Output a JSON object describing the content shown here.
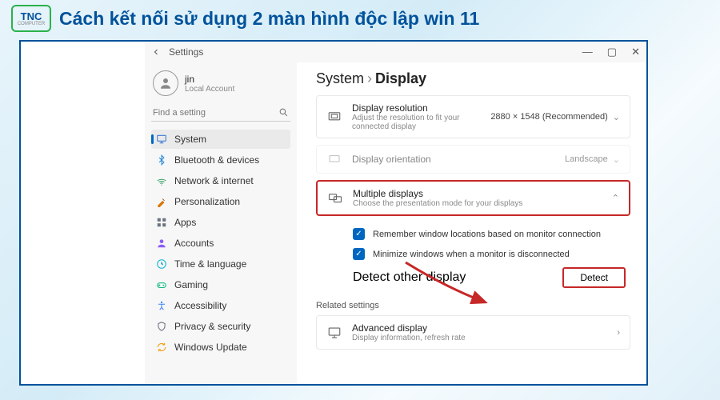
{
  "article": {
    "title": "Cách kết nối sử dụng 2 màn hình độc lập win 11",
    "logo_top": "TNC",
    "logo_bottom": "COMPUTER"
  },
  "window": {
    "title": "Settings",
    "controls": {
      "min": "—",
      "max": "▢",
      "close": "✕"
    },
    "user": {
      "name": "jin",
      "type": "Local Account"
    },
    "search_placeholder": "Find a setting",
    "nav": [
      {
        "label": "System",
        "icon": "system",
        "active": true
      },
      {
        "label": "Bluetooth & devices",
        "icon": "bt"
      },
      {
        "label": "Network & internet",
        "icon": "net"
      },
      {
        "label": "Personalization",
        "icon": "pers"
      },
      {
        "label": "Apps",
        "icon": "apps"
      },
      {
        "label": "Accounts",
        "icon": "acct"
      },
      {
        "label": "Time & language",
        "icon": "time"
      },
      {
        "label": "Gaming",
        "icon": "game"
      },
      {
        "label": "Accessibility",
        "icon": "access"
      },
      {
        "label": "Privacy & security",
        "icon": "priv"
      },
      {
        "label": "Windows Update",
        "icon": "upd"
      }
    ],
    "breadcrumb": {
      "root": "System",
      "page": "Display"
    },
    "resolution": {
      "title": "Display resolution",
      "desc": "Adjust the resolution to fit your connected display",
      "value": "2880 × 1548 (Recommended)"
    },
    "orientation": {
      "title": "Display orientation",
      "value": "Landscape"
    },
    "multiple": {
      "title": "Multiple displays",
      "desc": "Choose the presentation mode for your displays",
      "opt1": "Remember window locations based on monitor connection",
      "opt2": "Minimize windows when a monitor is disconnected",
      "detect_label": "Detect other display",
      "detect_btn": "Detect"
    },
    "related_hdr": "Related settings",
    "advanced": {
      "title": "Advanced display",
      "desc": "Display information, refresh rate"
    }
  }
}
